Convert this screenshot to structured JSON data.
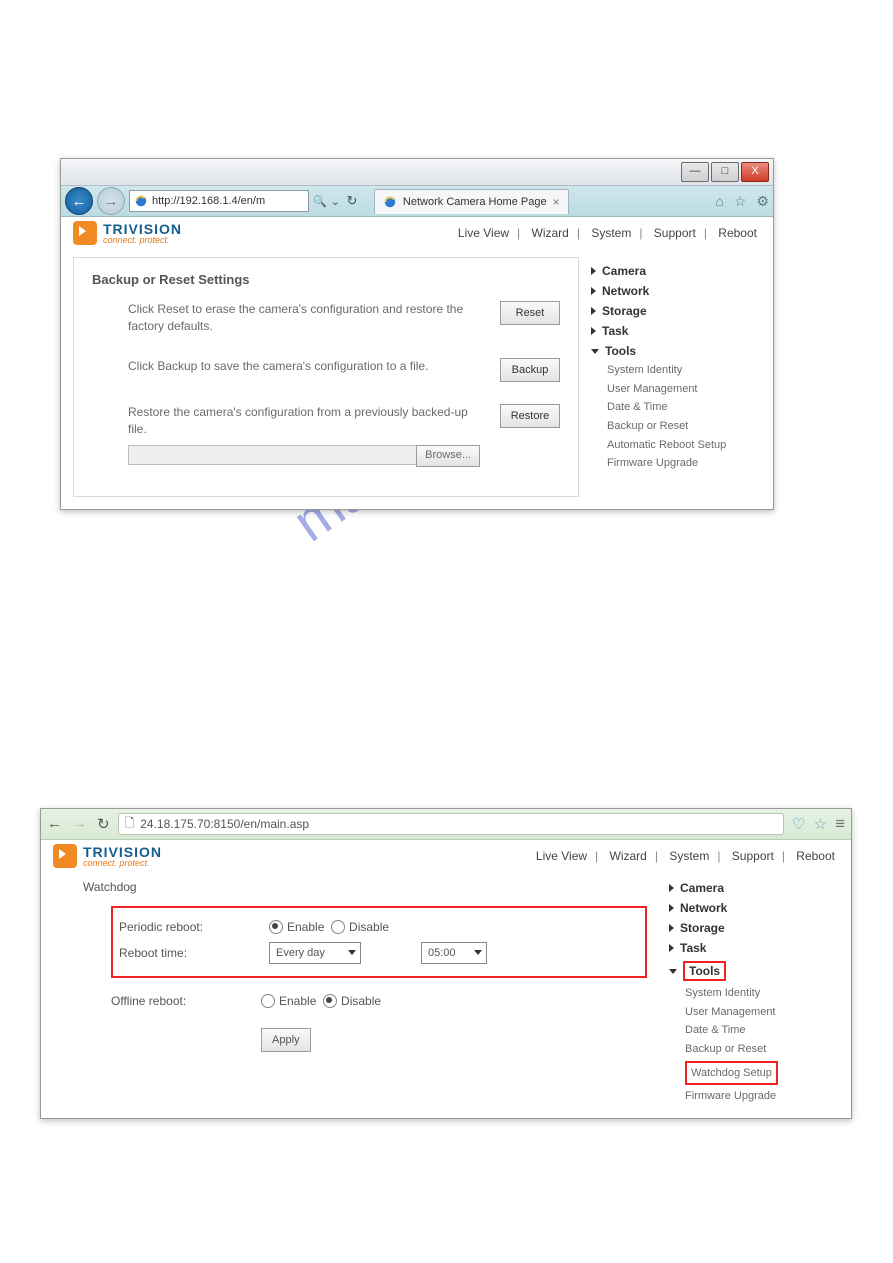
{
  "watermark": "manualshive.com",
  "win1": {
    "titlebar": {
      "min": "—",
      "max": "□",
      "close": "X"
    },
    "url": "http://192.168.1.4/en/m",
    "url_hint": "⌄",
    "refresh": "↻",
    "search_hint": "🔍",
    "tab_title": "Network Camera Home Page",
    "tab_close": "×",
    "extras": {
      "home": "⌂",
      "star": "☆",
      "gear": "⚙"
    },
    "logo_text": "TRIVISION",
    "logo_sub": "connect. protect.",
    "topnav": [
      "Live View",
      "Wizard",
      "System",
      "Support",
      "Reboot"
    ],
    "panel_title": "Backup or Reset Settings",
    "rows": [
      {
        "text": "Click Reset to erase the camera's configuration and restore the factory defaults.",
        "btn": "Reset"
      },
      {
        "text": "Click Backup to save the camera's configuration to a file.",
        "btn": "Backup"
      },
      {
        "text": "Restore the camera's configuration from a previously backed-up file.",
        "btn": "Restore",
        "browse": "Browse..."
      }
    ],
    "side": {
      "items": [
        "Camera",
        "Network",
        "Storage",
        "Task",
        "Tools"
      ],
      "tools_sub": [
        "System Identity",
        "User Management",
        "Date & Time",
        "Backup or Reset",
        "Automatic Reboot Setup",
        "Firmware Upgrade"
      ]
    }
  },
  "win2": {
    "nav": {
      "back": "←",
      "fwd": "→",
      "reload": "↻"
    },
    "url": "24.18.175.70:8150/en/main.asp",
    "shield": "◯",
    "star": "☆",
    "menu": "≡",
    "logo_text": "TRIVISION",
    "logo_sub": "connect. protect.",
    "topnav": [
      "Live View",
      "Wizard",
      "System",
      "Support",
      "Reboot"
    ],
    "panel_title": "Watchdog",
    "periodic_label": "Periodic reboot:",
    "enable": "Enable",
    "disable": "Disable",
    "reboot_time_label": "Reboot time:",
    "reboot_freq": "Every day",
    "reboot_hour": "05:00",
    "offline_label": "Offline reboot:",
    "apply": "Apply",
    "side": {
      "items": [
        "Camera",
        "Network",
        "Storage",
        "Task",
        "Tools"
      ],
      "tools_sub": [
        "System Identity",
        "User Management",
        "Date & Time",
        "Backup or Reset",
        "Watchdog Setup",
        "Firmware Upgrade"
      ]
    }
  }
}
